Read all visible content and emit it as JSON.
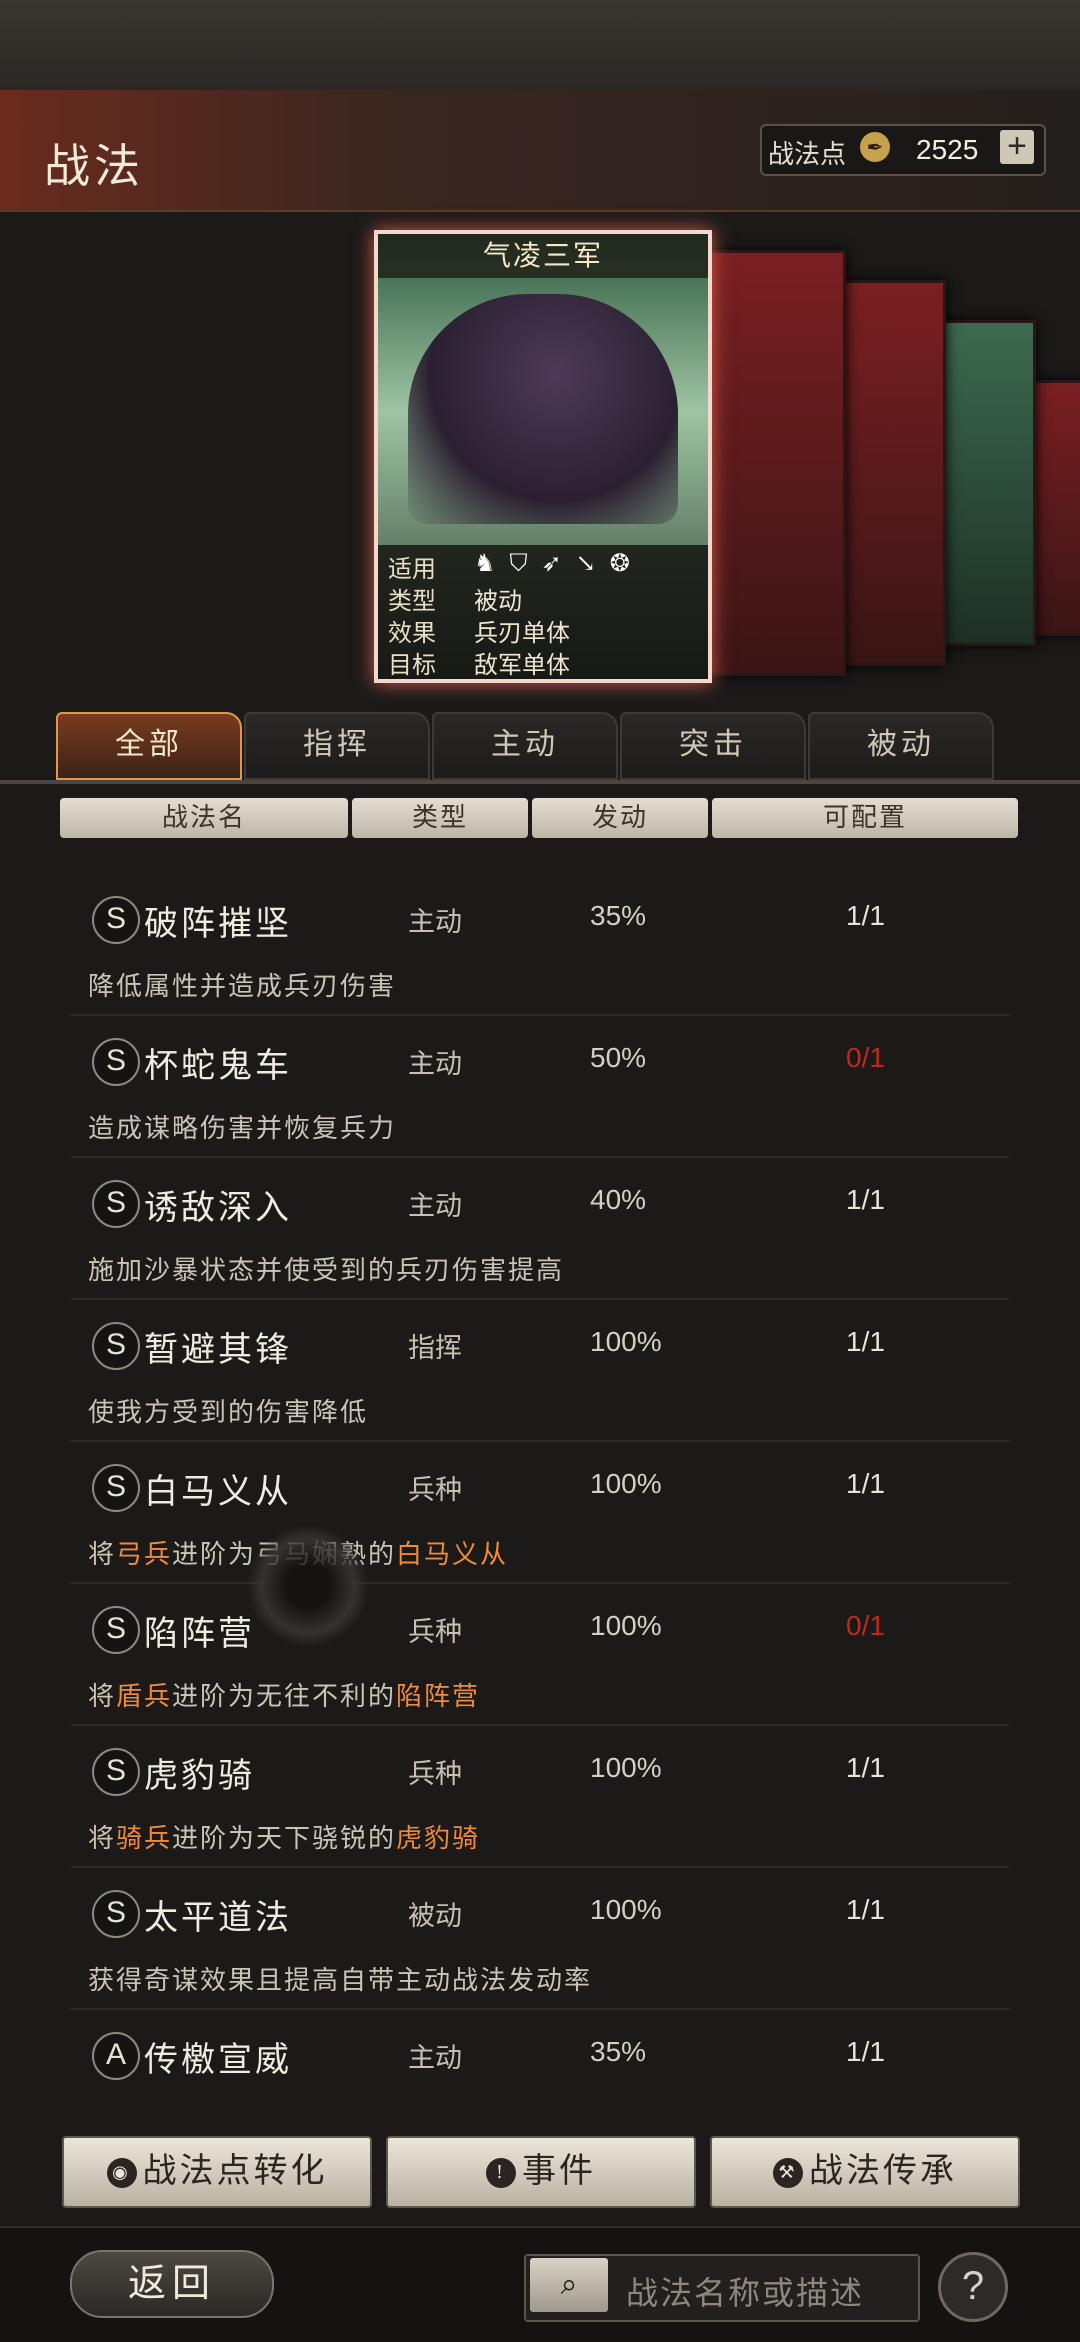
{
  "header": {
    "title": "战法",
    "points_label": "战法点",
    "points_icon": "feather-coin-icon",
    "points_value": "2525",
    "plus_label": "+"
  },
  "card": {
    "title": "气凌三军",
    "rows": [
      {
        "key": "适用",
        "value": ""
      },
      {
        "key": "类型",
        "value": "被动"
      },
      {
        "key": "效果",
        "value": "兵刃单体"
      },
      {
        "key": "目标",
        "value": "敌军单体"
      }
    ],
    "troop_icons": [
      "cavalry-icon",
      "shield-icon",
      "bow-icon",
      "spear-icon",
      "wheel-icon"
    ]
  },
  "tabs": [
    "全部",
    "指挥",
    "主动",
    "突击",
    "被动"
  ],
  "active_tab": "全部",
  "columns": [
    "战法名",
    "类型",
    "发动",
    "可配置"
  ],
  "skills": [
    {
      "grade": "S",
      "name": "破阵摧坚",
      "type": "主动",
      "rate": "35%",
      "slots": "1/1",
      "desc": "降低属性并造成兵刃伤害"
    },
    {
      "grade": "S",
      "name": "杯蛇鬼车",
      "type": "主动",
      "rate": "50%",
      "slots": "0/1",
      "desc": "造成谋略伤害并恢复兵力"
    },
    {
      "grade": "S",
      "name": "诱敌深入",
      "type": "主动",
      "rate": "40%",
      "slots": "1/1",
      "desc": "施加沙暴状态并使受到的兵刃伤害提高"
    },
    {
      "grade": "S",
      "name": "暂避其锋",
      "type": "指挥",
      "rate": "100%",
      "slots": "1/1",
      "desc": "使我方受到的伤害降低"
    },
    {
      "grade": "S",
      "name": "白马义从",
      "type": "兵种",
      "rate": "100%",
      "slots": "1/1",
      "desc_parts": [
        "将",
        "弓兵",
        "进阶为弓马娴熟的",
        "白马义从"
      ]
    },
    {
      "grade": "S",
      "name": "陷阵营",
      "type": "兵种",
      "rate": "100%",
      "slots": "0/1",
      "desc_parts": [
        "将",
        "盾兵",
        "进阶为无往不利的",
        "陷阵营"
      ]
    },
    {
      "grade": "S",
      "name": "虎豹骑",
      "type": "兵种",
      "rate": "100%",
      "slots": "1/1",
      "desc_parts": [
        "将",
        "骑兵",
        "进阶为天下骁锐的",
        "虎豹骑"
      ]
    },
    {
      "grade": "S",
      "name": "太平道法",
      "type": "被动",
      "rate": "100%",
      "slots": "1/1",
      "desc": "获得奇谋效果且提高自带主动战法发动率"
    },
    {
      "grade": "A",
      "name": "传檄宣威",
      "type": "主动",
      "rate": "35%",
      "slots": "1/1",
      "desc": ""
    }
  ],
  "bottom_buttons": [
    {
      "label": "战法点转化",
      "icon": "coin-icon"
    },
    {
      "label": "事件",
      "icon": "alert-scroll-icon"
    },
    {
      "label": "战法传承",
      "icon": "hammer-icon"
    }
  ],
  "footer": {
    "back_label": "返回",
    "search_placeholder": "战法名称或描述",
    "help_label": "?"
  },
  "colors": {
    "highlight": "#f08a3c",
    "unavailable": "#c0281f",
    "active_tab": "#e0974b"
  }
}
